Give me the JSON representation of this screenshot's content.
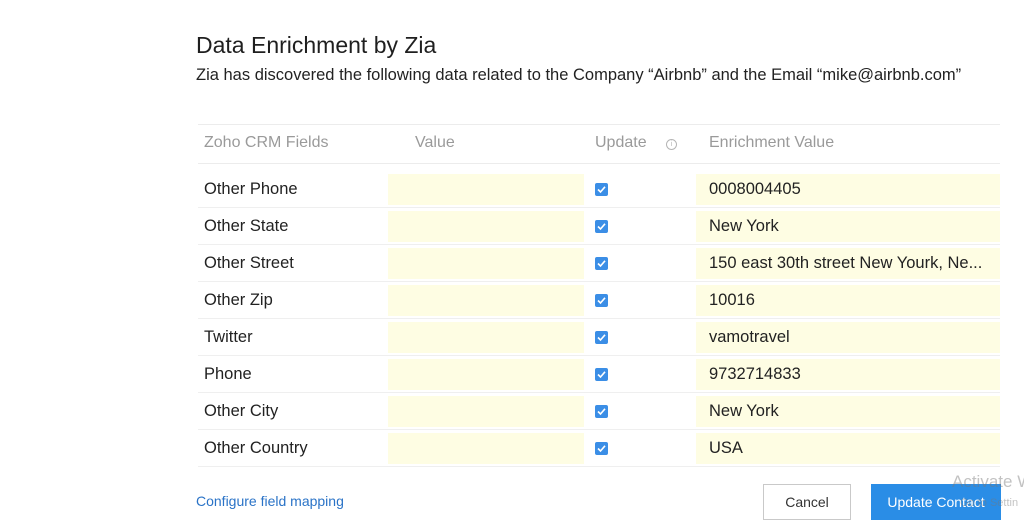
{
  "dialog": {
    "title": "Data Enrichment by Zia",
    "subtitle": "Zia has discovered the following data related to the Company “Airbnb” and the Email “mike@airbnb.com”"
  },
  "table": {
    "headers": {
      "field": "Zoho CRM Fields",
      "value": "Value",
      "update": "Update",
      "enrichment": "Enrichment Value"
    },
    "rows": [
      {
        "field": "Other Phone",
        "value": "",
        "update": true,
        "enrichment": "0008004405"
      },
      {
        "field": "Other State",
        "value": "",
        "update": true,
        "enrichment": "New York"
      },
      {
        "field": "Other Street",
        "value": "",
        "update": true,
        "enrichment": "150 east 30th street New Yourk, Ne..."
      },
      {
        "field": "Other Zip",
        "value": "",
        "update": true,
        "enrichment": "10016"
      },
      {
        "field": "Twitter",
        "value": "",
        "update": true,
        "enrichment": "vamotravel"
      },
      {
        "field": "Phone",
        "value": "",
        "update": true,
        "enrichment": "9732714833"
      },
      {
        "field": "Other City",
        "value": "",
        "update": true,
        "enrichment": "New York"
      },
      {
        "field": "Other Country",
        "value": "",
        "update": true,
        "enrichment": "USA"
      }
    ]
  },
  "footer": {
    "configure_link": "Configure field mapping",
    "cancel_label": "Cancel",
    "update_label": "Update Contact"
  },
  "watermark": {
    "line1": "Activate W",
    "line2": "Go to Settin"
  },
  "colors": {
    "accent": "#2a8de6",
    "highlight": "#fefde3",
    "link": "#2a73c7"
  }
}
